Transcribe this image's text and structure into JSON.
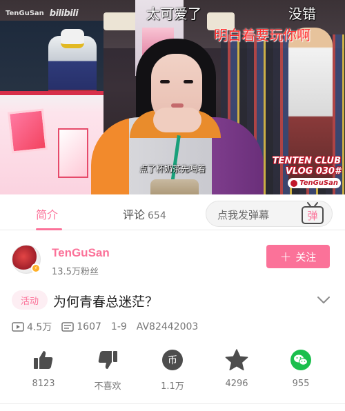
{
  "video": {
    "watermark_user": "TenGuSan",
    "watermark_logo": "bilibili",
    "danmaku": [
      "太可爱了",
      "没错",
      "明白着要玩你啊"
    ],
    "subtitle": "点了杯奶茶先喝着",
    "club_line1": "TENTEN CLUB",
    "club_line2": "VLOG 030#",
    "club_sign": "TenGuSan"
  },
  "tabs": {
    "intro": "简介",
    "comments": "评论",
    "comments_count": "654",
    "danmaku_placeholder": "点我发弹幕",
    "danmaku_button": "弹"
  },
  "uploader": {
    "name": "TenGuSan",
    "fans": "13.5万粉丝",
    "follow_plus": "+",
    "follow_label": "关注"
  },
  "video_info": {
    "tag": "活动",
    "title": "为何青春总迷茫？",
    "views": "4.5万",
    "danmaku_count": "1607",
    "date": "1-9",
    "av_id": "AV82442003"
  },
  "actions": {
    "like": "8123",
    "dislike": "不喜欢",
    "coin": "1.1万",
    "coin_glyph": "币",
    "favorite": "4296",
    "share": "955"
  },
  "colors": {
    "accent": "#fb7299",
    "icon_gray": "#4d4d4d",
    "wechat_green": "#1bbf4d"
  }
}
